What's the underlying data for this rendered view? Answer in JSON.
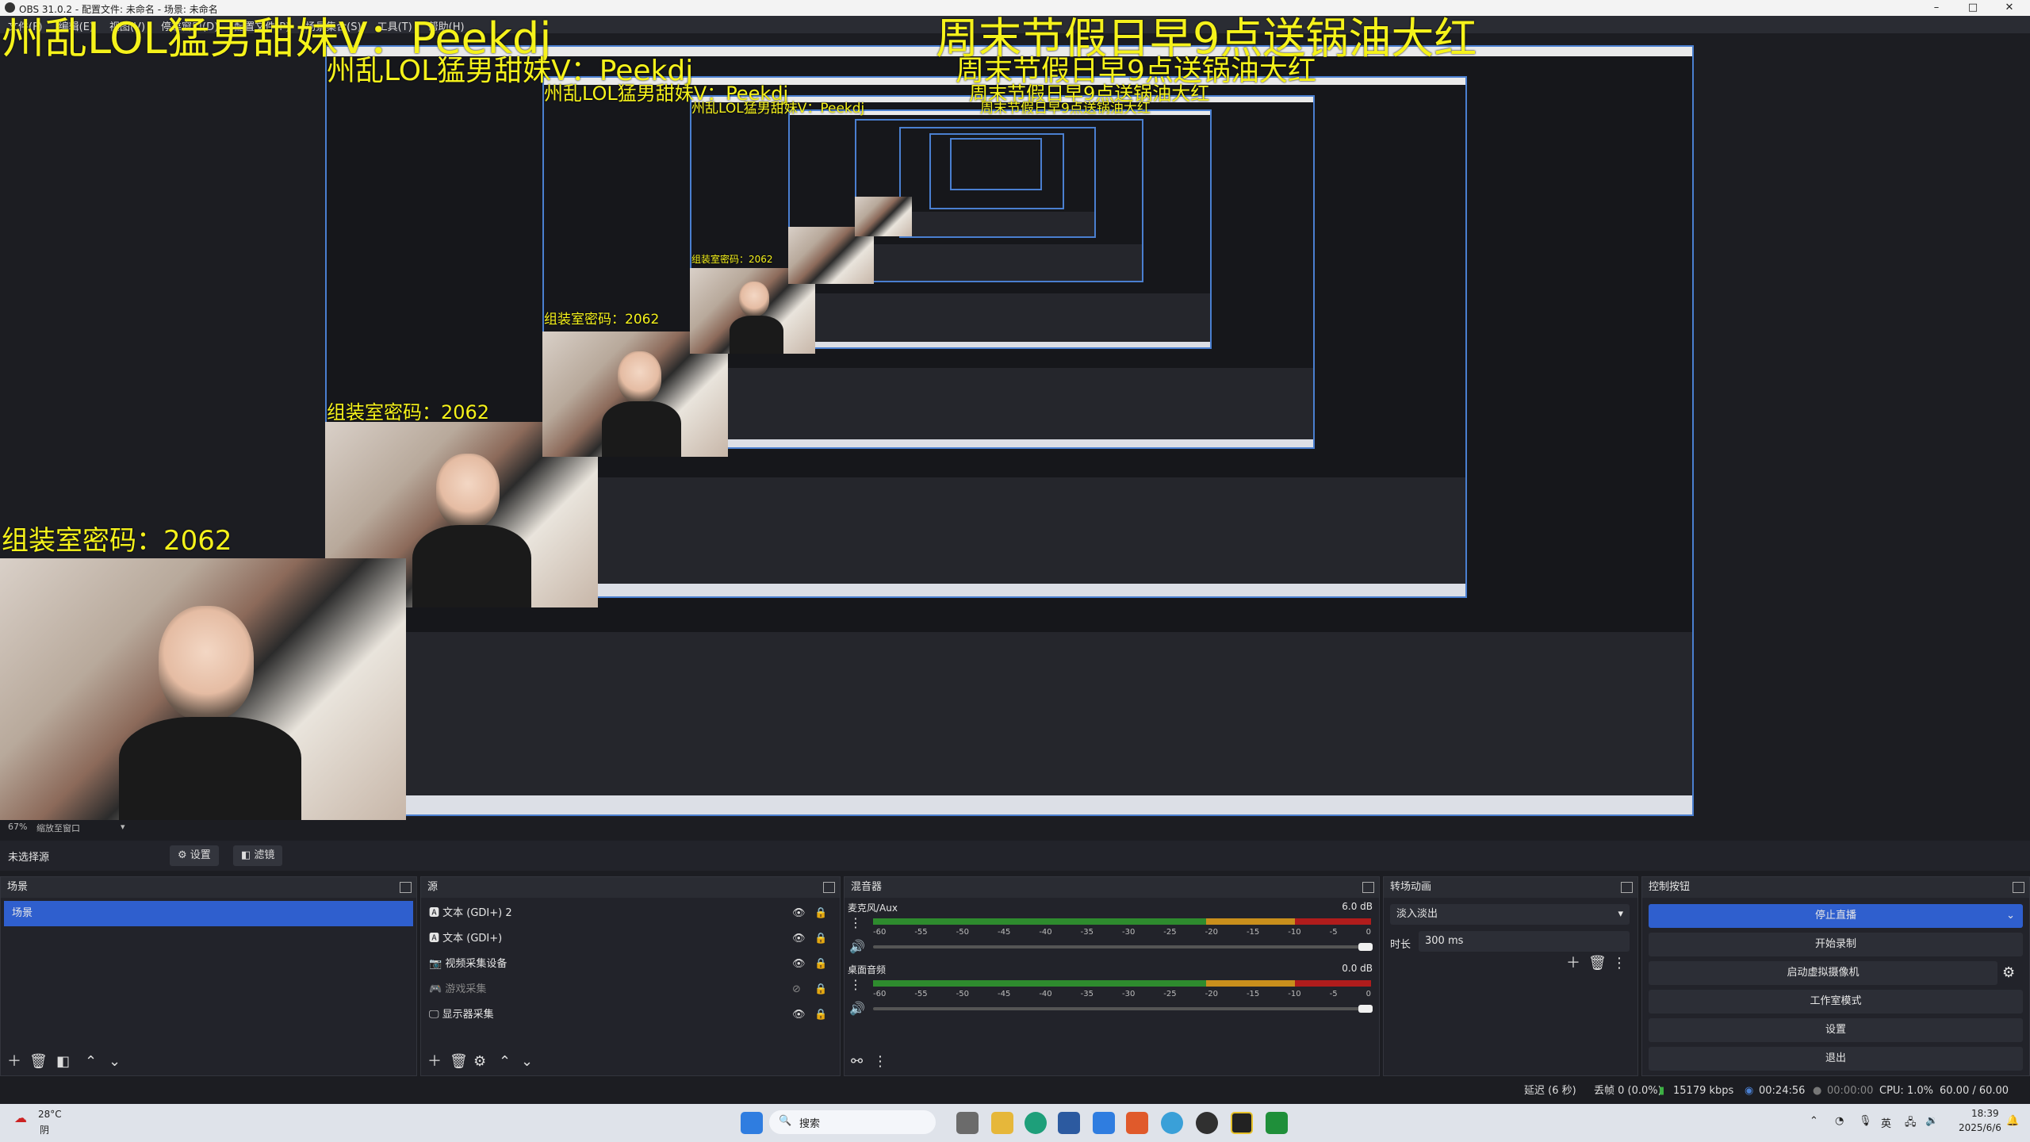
{
  "window": {
    "title": "OBS 31.0.2 - 配置文件: 未命名 - 场景: 未命名",
    "min": "–",
    "max": "□",
    "close": "✕"
  },
  "menu": [
    "文件(F)",
    "编辑(E)",
    "视图(V)",
    "停靠窗口(D)",
    "配置文件(P)",
    "场景集合(S)",
    "工具(T)",
    "帮助(H)"
  ],
  "overlay": {
    "streamer": "州乱LOL猛男甜妹V：Peekdj",
    "promo": "周末节假日早9点送锅油大红",
    "room_code": "组装室密码：2062"
  },
  "preview": {
    "zoom": "67%",
    "zoom_mode": "缩放至窗口"
  },
  "source_toolbar": {
    "no_source": "未选择源",
    "settings": "设置",
    "filters": "滤镜"
  },
  "scenes": {
    "title": "场景",
    "items": [
      "场景"
    ]
  },
  "sources": {
    "title": "源",
    "items": [
      {
        "label": "文本 (GDI+) 2",
        "icon": "text-icon"
      },
      {
        "label": "文本 (GDI+)",
        "icon": "text-icon"
      },
      {
        "label": "视频采集设备",
        "icon": "camera-icon"
      },
      {
        "label": "游戏采集",
        "icon": "gamepad-icon",
        "hidden": true
      },
      {
        "label": "显示器采集",
        "icon": "monitor-icon"
      }
    ]
  },
  "mixer": {
    "title": "混音器",
    "channels": [
      {
        "name": "麦克风/Aux",
        "db": "6.0 dB",
        "level": 0.92
      },
      {
        "name": "桌面音频",
        "db": "0.0 dB",
        "level": 0.72
      }
    ],
    "ticks": [
      "-60",
      "-55",
      "-50",
      "-45",
      "-40",
      "-35",
      "-30",
      "-25",
      "-20",
      "-15",
      "-10",
      "-5",
      "0"
    ]
  },
  "transitions": {
    "title": "转场动画",
    "selected": "淡入淡出",
    "duration_label": "时长",
    "duration": "300 ms"
  },
  "controls": {
    "title": "控制按钮",
    "buttons": [
      "停止直播",
      "开始录制",
      "启动虚拟摄像机",
      "工作室模式",
      "设置",
      "退出"
    ]
  },
  "status": {
    "delay": "延迟 (6 秒)",
    "dropped": "丢帧 0 (0.0%)",
    "bitrate": "15179 kbps",
    "stream_time": "00:24:56",
    "rec_time": "00:00:00",
    "cpu": "CPU: 1.0%",
    "fps": "60.00 / 60.00 FPS"
  },
  "taskbar": {
    "weather_temp": "28°C",
    "weather_desc": "阴",
    "search": "搜索",
    "ime": "英",
    "time": "18:39",
    "date": "2025/6/6"
  },
  "colors": {
    "accent": "#2f5fce",
    "overlay_yellow": "#f5f21b",
    "panel": "#22232a",
    "bg": "#1c1d22"
  }
}
